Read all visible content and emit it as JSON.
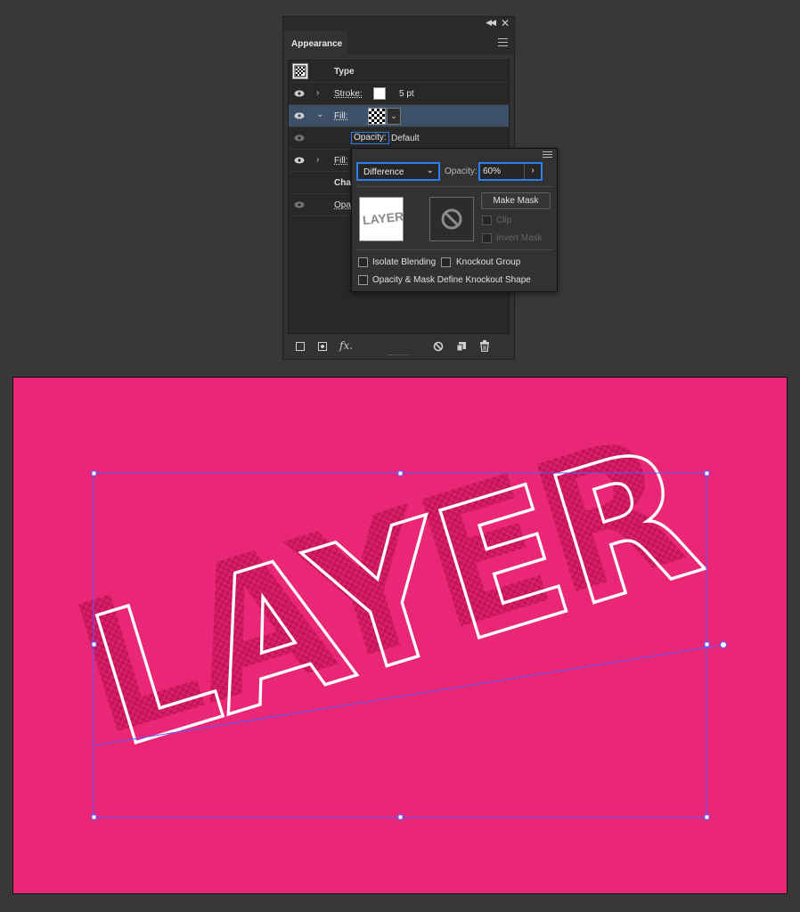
{
  "panel": {
    "tab_title": "Appearance",
    "rows": [
      {
        "label": "Type"
      },
      {
        "label": "Stroke:",
        "value": "5 pt"
      },
      {
        "label": "Fill:"
      },
      {
        "label": "Opacity:",
        "value": "Default"
      },
      {
        "label": "Fill:"
      },
      {
        "label": "Char"
      },
      {
        "label": "Opac"
      }
    ],
    "footer_fx": "fx."
  },
  "transparency": {
    "blend_mode": "Difference",
    "opacity_label": "Opacity:",
    "opacity_value": "60%",
    "thumbnail_text": "LAYER",
    "make_mask_label": "Make Mask",
    "clip_label": "Clip",
    "invert_mask_label": "Invert Mask",
    "isolate_blending_label": "Isolate Blending",
    "knockout_group_label": "Knockout Group",
    "opacity_mask_knockout_label": "Opacity & Mask Define Knockout Shape"
  },
  "artboard": {
    "text": "LAYER",
    "background_color": "#ea2777",
    "selection_color": "#5a5aff"
  },
  "icons": [
    "collapse-icon",
    "close-icon",
    "panel-menu-icon",
    "eye-icon",
    "chevron-right-icon",
    "chevron-down-icon",
    "new-stroke-icon",
    "new-fill-icon",
    "fx-icon",
    "clear-appearance-icon",
    "duplicate-item-icon",
    "delete-icon",
    "prohibited-icon"
  ]
}
